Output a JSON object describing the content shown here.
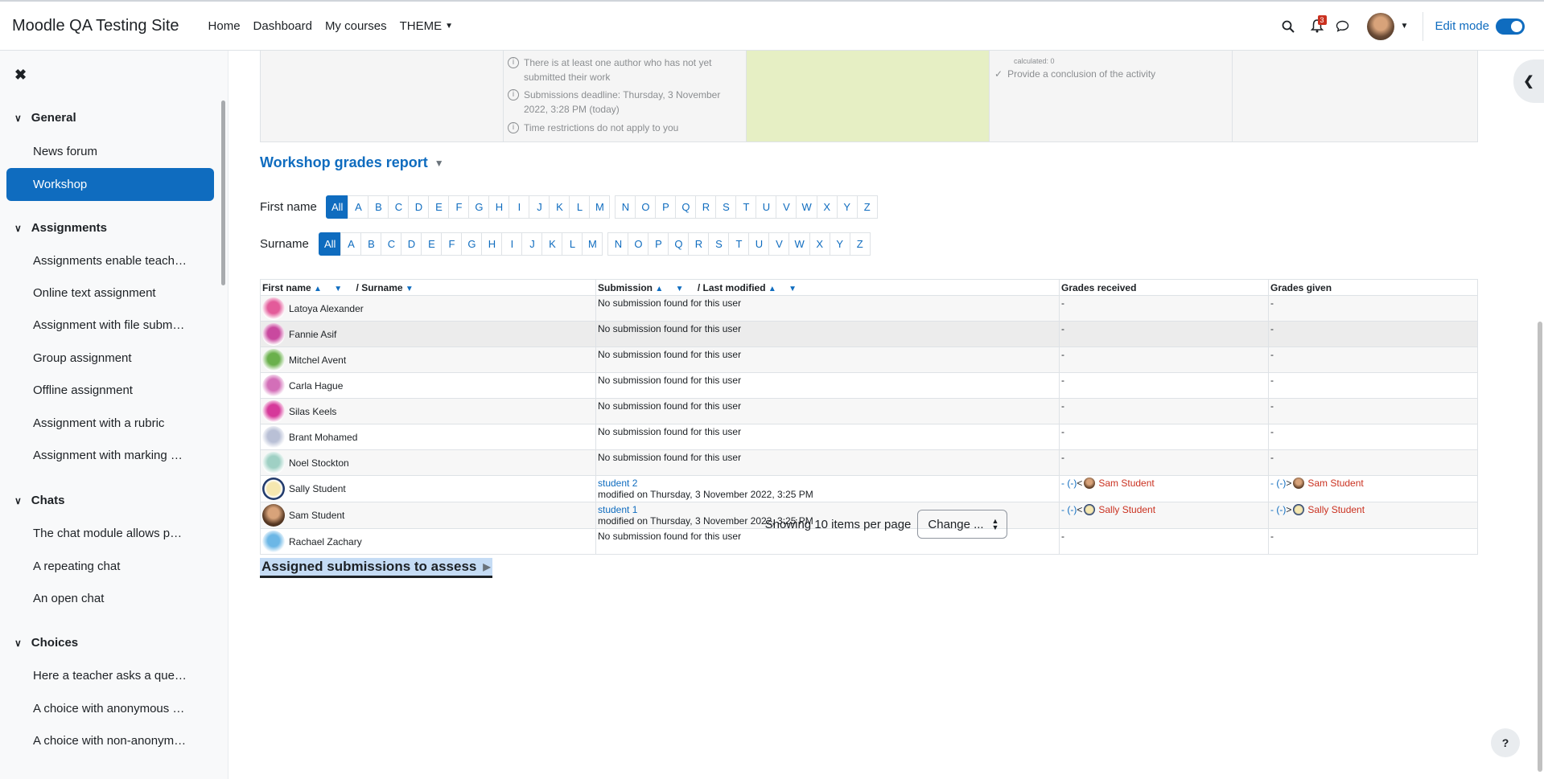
{
  "navbar": {
    "brand": "Moodle QA Testing Site",
    "links": [
      "Home",
      "Dashboard",
      "My courses",
      "THEME"
    ],
    "notification_count": "3",
    "edit_mode_label": "Edit mode"
  },
  "drawer": {
    "sections": [
      {
        "title": "General",
        "items": [
          "News forum",
          "Workshop"
        ]
      },
      {
        "title": "Assignments",
        "items": [
          "Assignments enable teach…",
          "Online text assignment",
          "Assignment with file subm…",
          "Group assignment",
          "Offline assignment",
          "Assignment with a rubric",
          "Assignment with marking …"
        ]
      },
      {
        "title": "Chats",
        "items": [
          "The chat module allows p…",
          "A repeating chat",
          "An open chat"
        ]
      },
      {
        "title": "Choices",
        "items": [
          "Here a teacher asks a que…",
          "A choice with anonymous …",
          "A choice with non-anonym…"
        ]
      }
    ]
  },
  "phase": {
    "note1": "There is at least one author who has not yet submitted their work",
    "note2": "Submissions deadline: Thursday, 3 November 2022, 3:28 PM (today)",
    "note3": "Time restrictions do not apply to you",
    "calc": "calculated: 0",
    "conclusion": "Provide a conclusion of the activity"
  },
  "report": {
    "title": "Workshop grades report",
    "first_name_label": "First name",
    "surname_label": "Surname",
    "all_label": "All",
    "letters": [
      "A",
      "B",
      "C",
      "D",
      "E",
      "F",
      "G",
      "H",
      "I",
      "J",
      "K",
      "L",
      "M",
      "N",
      "O",
      "P",
      "Q",
      "R",
      "S",
      "T",
      "U",
      "V",
      "W",
      "X",
      "Y",
      "Z"
    ]
  },
  "table": {
    "headers": {
      "first_name": "First name",
      "surname": "/ Surname",
      "submission": "Submission",
      "last_modified": "/ Last modified",
      "grades_received": "Grades received",
      "grades_given": "Grades given"
    },
    "no_submission": "No submission found for this user",
    "rows": [
      {
        "name": "Latoya Alexander",
        "color": "#e35b9a"
      },
      {
        "name": "Fannie Asif",
        "color": "#c9499f"
      },
      {
        "name": "Mitchel Avent",
        "color": "#6ab04c"
      },
      {
        "name": "Carla Hague",
        "color": "#d36fb8"
      },
      {
        "name": "Silas Keels",
        "color": "#d6399a"
      },
      {
        "name": "Brant Mohamed",
        "color": "#b9c0d6"
      },
      {
        "name": "Noel Stockton",
        "color": "#9fd0c4"
      },
      {
        "name": "Sally Student",
        "submission": "student 2",
        "modified": "modified on Thursday, 3 November 2022, 3:25 PM",
        "received_from": "Sam Student",
        "given_to": "Sam Student"
      },
      {
        "name": "Sam Student",
        "submission": "student 1",
        "modified": "modified on Thursday, 3 November 2022, 3:25 PM",
        "received_from": "Sally Student",
        "given_to": "Sally Student"
      },
      {
        "name": "Rachael Zachary",
        "color": "#6cb7e6"
      }
    ],
    "dash": "-",
    "grade_prefix": "- (-)",
    "received_arrow": "<",
    "given_arrow": ">"
  },
  "paging": {
    "text": "Showing 10 items per page",
    "select_value": "Change ..."
  },
  "assigned_title": "Assigned submissions to assess"
}
